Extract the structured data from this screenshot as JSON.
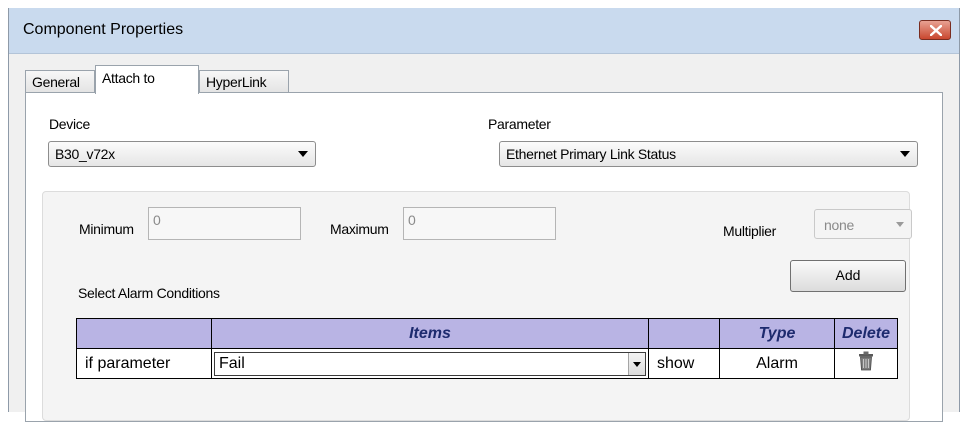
{
  "window": {
    "title": "Component Properties"
  },
  "tabs": [
    {
      "label": "General",
      "active": false
    },
    {
      "label": "Attach to",
      "active": true
    },
    {
      "label": "HyperLink",
      "active": false
    }
  ],
  "device": {
    "label": "Device",
    "value": "B30_v72x"
  },
  "parameter": {
    "label": "Parameter",
    "value": "Ethernet Primary Link Status"
  },
  "range": {
    "minimum_label": "Minimum",
    "minimum_value": "0",
    "maximum_label": "Maximum",
    "maximum_value": "0",
    "multiplier_label": "Multiplier",
    "multiplier_value": "none"
  },
  "alarm": {
    "section_label": "Select Alarm Conditions",
    "add_label": "Add",
    "columns": [
      "",
      "Items",
      "",
      "Type",
      "Delete"
    ],
    "rows": [
      {
        "condition": "if parameter",
        "item": "Fail",
        "action": "show",
        "type": "Alarm",
        "delete_icon": "trash-icon"
      }
    ]
  },
  "colors": {
    "titlebar": "#c9daee",
    "close_button": "#c9472f",
    "table_header": "#b9b4e4",
    "table_header_text": "#1d2a6e"
  }
}
